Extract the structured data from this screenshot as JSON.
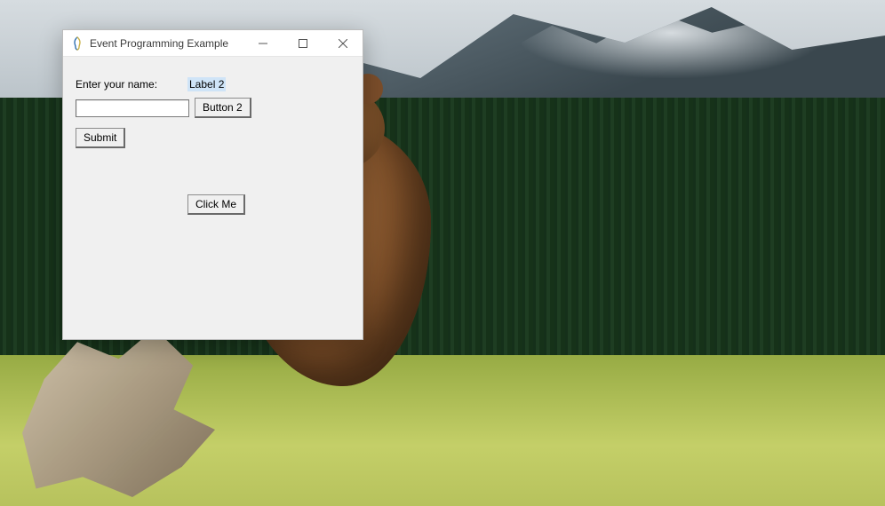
{
  "window": {
    "title": "Event Programming Example"
  },
  "form": {
    "label1": "Enter your name:",
    "label2": "Label 2",
    "entry1_value": "",
    "button2": "Button 2",
    "submit": "Submit",
    "click_me": "Click Me"
  }
}
